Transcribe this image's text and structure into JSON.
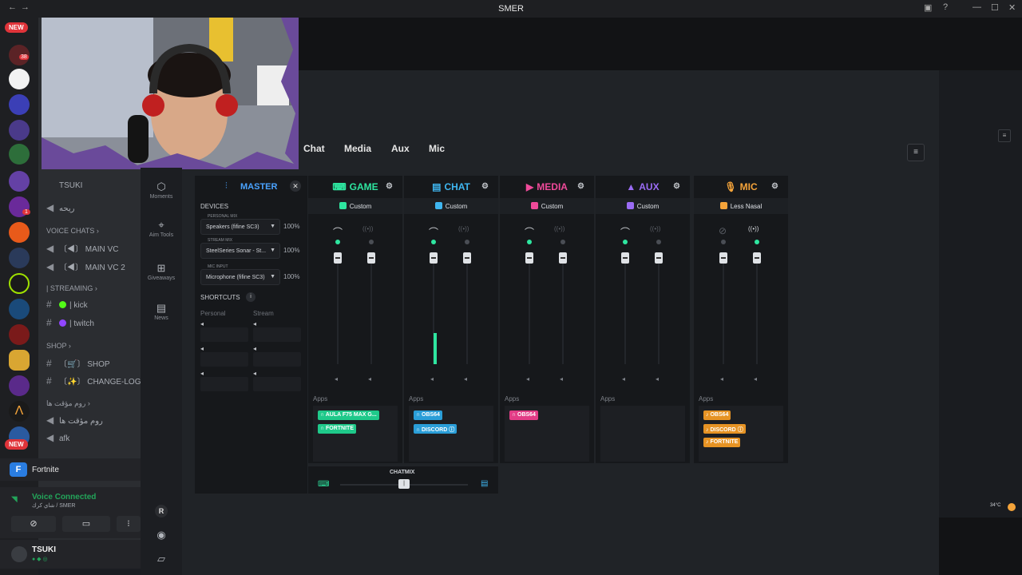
{
  "window": {
    "title": "SMER"
  },
  "discord": {
    "badges": [
      "NEW",
      "NEW"
    ],
    "server_counts": [
      "38",
      "1"
    ],
    "channels": {
      "top_user": "TSUKI",
      "rtl_channel": "ريحه",
      "voice_category": "VOICE CHATS",
      "voice": [
        "MAIN VC",
        "MAIN VC 2"
      ],
      "streaming_category": "| STREAMING",
      "streaming": [
        "| kick",
        "| twitch"
      ],
      "shop_category": "SHOP",
      "shop": [
        "SHOP",
        "CHANGE-LOG"
      ],
      "temp_category": "روم مؤقت ها",
      "temp_channel": "روم مؤقت ها",
      "afk": "afk"
    },
    "activity": "Fortnite",
    "voice_status": "Voice Connected",
    "voice_sub": "شاي كرك / SMER",
    "user": "TSUKI"
  },
  "sonar": {
    "top_tabs": [
      "Chat",
      "Media",
      "Aux",
      "Mic"
    ],
    "nav": [
      {
        "icon": "hexagon-icon",
        "label": "Moments"
      },
      {
        "icon": "crosshair-icon",
        "label": "Aim Tools"
      },
      {
        "icon": "gift-icon",
        "label": "Giveaways"
      },
      {
        "icon": "news-icon",
        "label": "News"
      }
    ],
    "nav_bottom": "R",
    "master": {
      "title": "MASTER",
      "devices_label": "DEVICES",
      "personal_mix_label": "PERSONAL MIX",
      "personal_device": "Speakers (fifine SC3)",
      "personal_pct": "100%",
      "stream_mix_label": "STREAM MIX",
      "stream_device": "SteelSeries Sonar - St...",
      "stream_pct": "100%",
      "mic_input_label": "MIC INPUT",
      "mic_device": "Microphone (fifine SC3)",
      "mic_pct": "100%",
      "shortcuts_label": "SHORTCUTS",
      "personal_label": "Personal",
      "stream_label": "Stream"
    },
    "columns": [
      {
        "name": "GAME",
        "color": "#2ee6a0",
        "preset": "Custom",
        "apps_label": "Apps",
        "level": 0.0,
        "apps": [
          {
            "label": "AULA F75 MAX G...",
            "color": "#1fc98a"
          },
          {
            "label": "FORTNITE",
            "color": "#1fc98a"
          }
        ]
      },
      {
        "name": "CHAT",
        "color": "#3fb6f0",
        "preset": "Custom",
        "apps_label": "Apps",
        "level": 0.4,
        "apps": [
          {
            "label": "OBS64",
            "color": "#2a9ed8"
          },
          {
            "label": "DISCORD",
            "color": "#2a9ed8"
          }
        ]
      },
      {
        "name": "MEDIA",
        "color": "#ef4a9a",
        "preset": "Custom",
        "apps_label": "Apps",
        "level": 0.0,
        "apps": [
          {
            "label": "OBS64",
            "color": "#e23c86"
          }
        ]
      },
      {
        "name": "AUX",
        "color": "#9b6cf5",
        "preset": "Custom",
        "apps_label": "Apps",
        "level": 0.0,
        "apps": []
      },
      {
        "name": "MIC",
        "color": "#f5a43a",
        "preset": "Less Nasal",
        "apps_label": "Apps",
        "level": 0.0,
        "apps": [
          {
            "label": "OBS64",
            "color": "#e69324"
          },
          {
            "label": "DISCORD",
            "color": "#e69324"
          },
          {
            "label": "FORTNITE",
            "color": "#e69324"
          }
        ]
      }
    ],
    "chatmix": {
      "label": "CHATMIX",
      "value": 0.5
    }
  },
  "tray": {
    "weather": "34°C"
  }
}
